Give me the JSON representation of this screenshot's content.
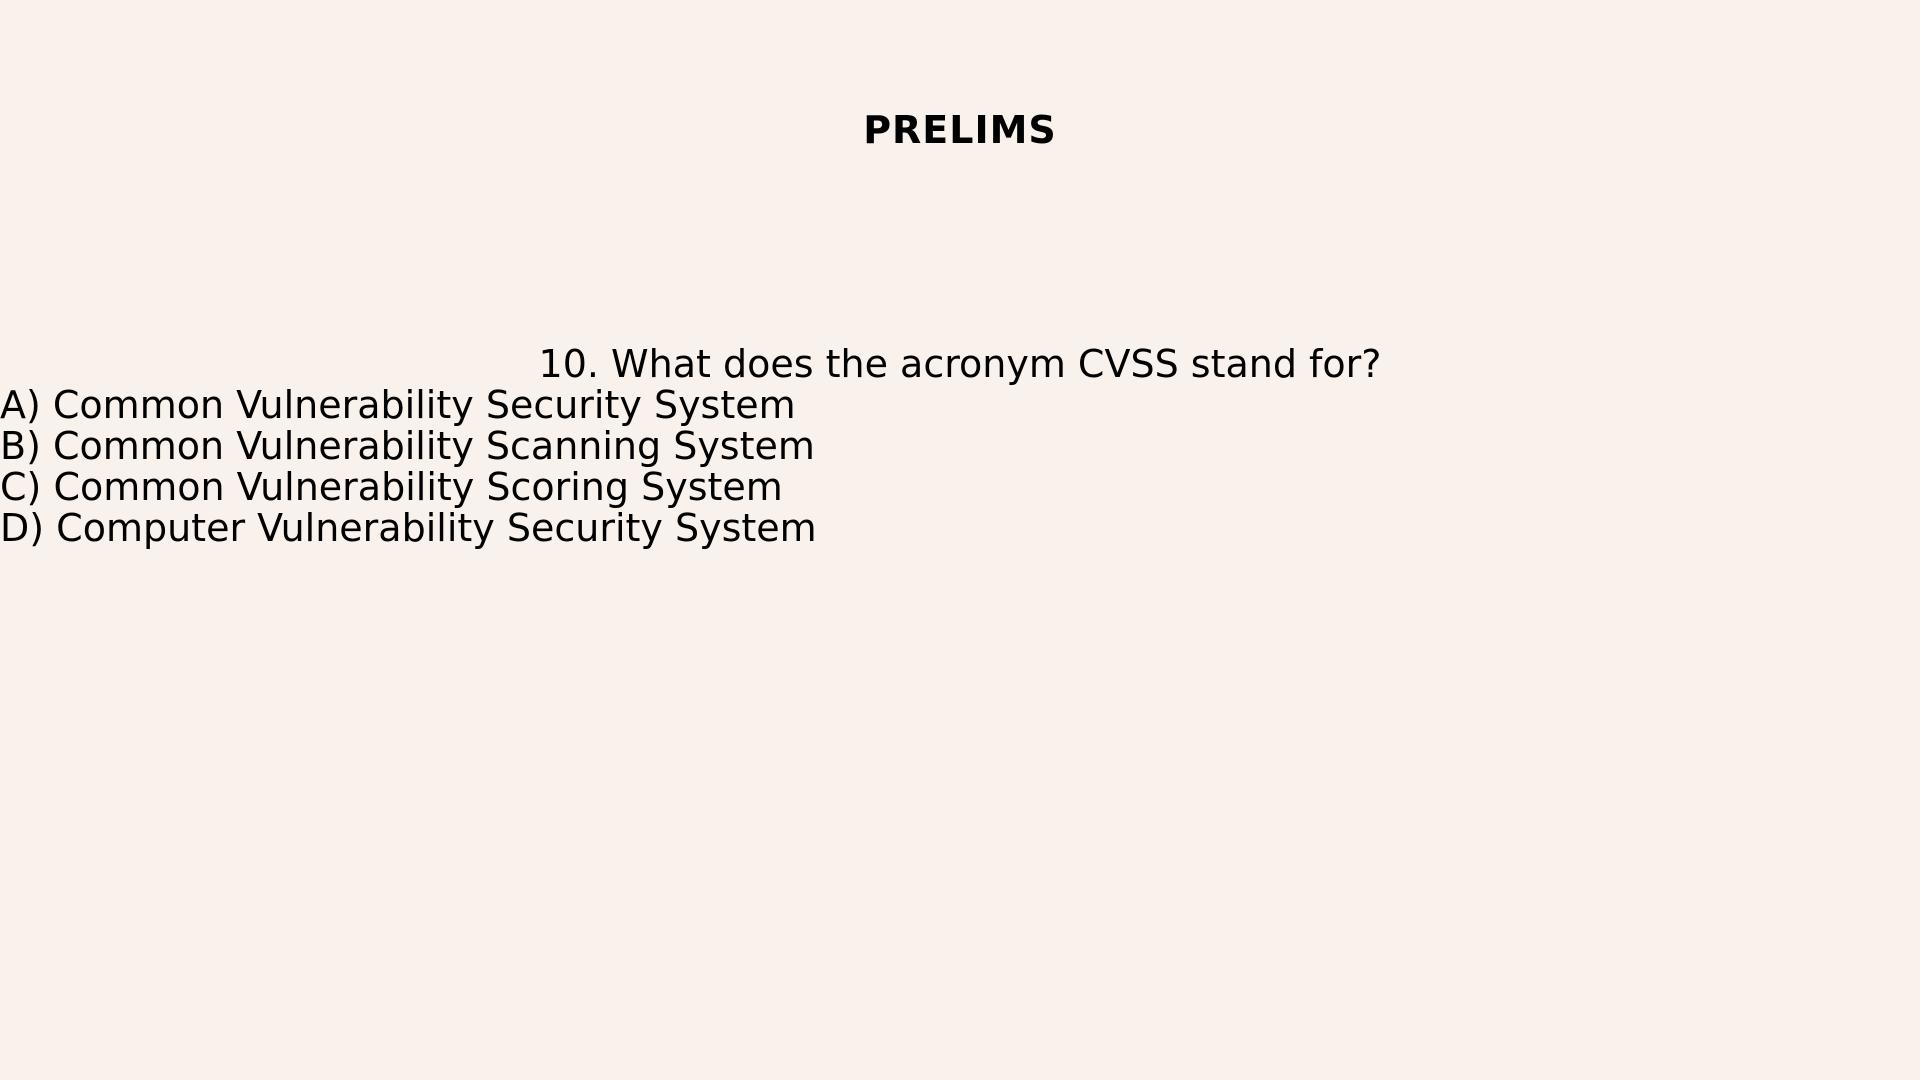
{
  "slide": {
    "title": "PRELIMS",
    "background_color": "#f8f1ec",
    "text_color": "#000000"
  },
  "question": {
    "text": "10. What does the acronym CVSS stand for?",
    "options": [
      {
        "label": "A) Common Vulnerability Security System"
      },
      {
        "label": "B) Common Vulnerability Scanning System"
      },
      {
        "label": "C) Common Vulnerability Scoring System"
      },
      {
        "label": "D) Computer Vulnerability Security System"
      }
    ]
  }
}
